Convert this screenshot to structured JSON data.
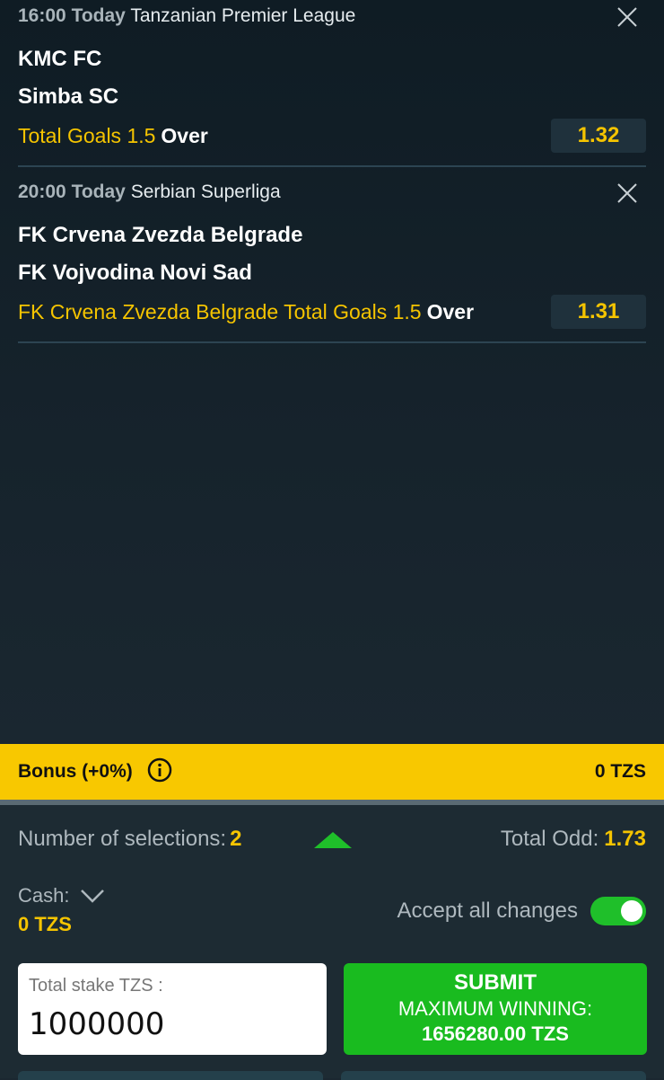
{
  "bets": [
    {
      "time": "16:00",
      "day": "Today",
      "league": "Tanzanian Premier League",
      "home": "KMC FC",
      "away": "Simba SC",
      "market": "Total Goals 1.5",
      "pick": "Over",
      "odd": "1.32"
    },
    {
      "time": "20:00",
      "day": "Today",
      "league": "Serbian Superliga",
      "home": "FK Crvena Zvezda Belgrade",
      "away": "FK Vojvodina Novi Sad",
      "market": "FK Crvena Zvezda Belgrade Total Goals 1.5",
      "pick": "Over",
      "odd": "1.31"
    }
  ],
  "bonus": {
    "label": "Bonus (+0%)",
    "amount": "0 TZS"
  },
  "summary": {
    "selections_label": "Number of selections:",
    "selections": "2",
    "total_odd_label": "Total Odd:",
    "total_odd": "1.73",
    "cash_label": "Cash:",
    "cash_value": "0 TZS",
    "accept_label": "Accept all changes",
    "accept_on": true
  },
  "stake": {
    "label": "Total stake TZS :",
    "value": "1000000"
  },
  "submit": {
    "label": "SUBMIT",
    "max_label": "MAXIMUM WINNING:",
    "max_value": "1656280.00 TZS"
  },
  "colors": {
    "accent": "#f5c400",
    "submit": "#19bb1f",
    "bg": "#1d2b33"
  }
}
